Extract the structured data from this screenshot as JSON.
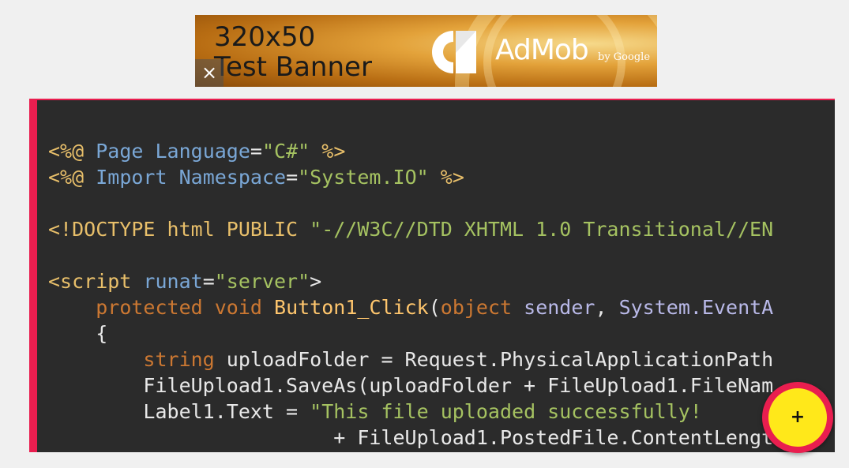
{
  "ad_banner": {
    "line1": "320x50",
    "line2": "Test Banner",
    "close_symbol": "×",
    "brand": "AdMob",
    "brand_by": "by Google"
  },
  "code": {
    "lines": [
      "<%@ Page Language=\"C#\" %>",
      "<%@ Import Namespace=\"System.IO\" %>",
      "",
      "<!DOCTYPE html PUBLIC \"-//W3C//DTD XHTML 1.0 Transitional//EN",
      "",
      "<script runat=\"server\">",
      "    protected void Button1_Click(object sender, System.EventA",
      "    {",
      "        string uploadFolder = Request.PhysicalApplicationPath",
      "        FileUpload1.SaveAs(uploadFolder + FileUpload1.FileNam",
      "        Label1.Text = \"This file uploaded successfully!",
      "                        + FileUpload1.PostedFile.ContentLengt"
    ]
  },
  "fab": {
    "label": "+",
    "icon": "plus-icon"
  },
  "colors": {
    "accent": "#e91e4f",
    "code_background": "#2b2b2b",
    "fab_fill": "#ffe81a"
  }
}
